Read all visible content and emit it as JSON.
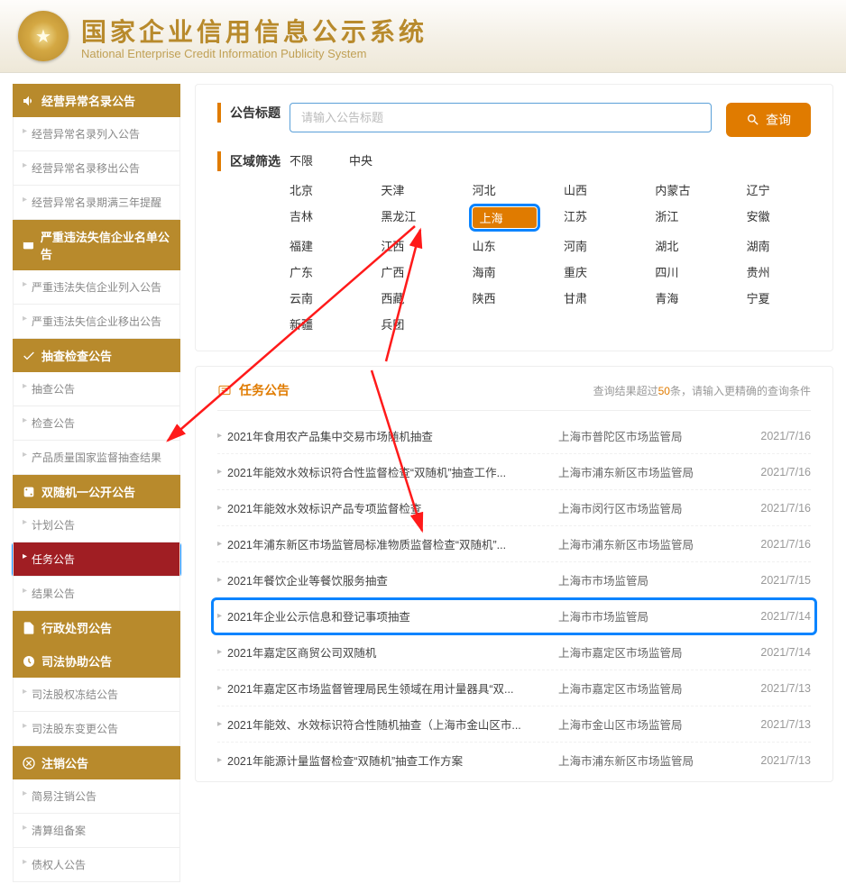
{
  "header": {
    "title_cn": "国家企业信用信息公示系统",
    "title_en": "National Enterprise Credit Information Publicity System"
  },
  "sidebar": [
    {
      "head": "经营异常名录公告",
      "icon": "speaker-icon",
      "items": [
        "经营异常名录列入公告",
        "经营异常名录移出公告",
        "经营异常名录期满三年提醒"
      ]
    },
    {
      "head": "严重违法失信企业名单公告",
      "icon": "warning-icon",
      "items": [
        "严重违法失信企业列入公告",
        "严重违法失信企业移出公告"
      ]
    },
    {
      "head": "抽查检查公告",
      "icon": "check-icon",
      "items": [
        "抽查公告",
        "检查公告",
        "产品质量国家监督抽查结果"
      ]
    },
    {
      "head": "双随机一公开公告",
      "icon": "dice-icon",
      "items": [
        "计划公告",
        "任务公告",
        "结果公告"
      ],
      "active_index": 1
    },
    {
      "head": "行政处罚公告",
      "icon": "doc-icon",
      "items": []
    },
    {
      "head": "司法协助公告",
      "icon": "gavel-icon",
      "items": [
        "司法股权冻结公告",
        "司法股东变更公告"
      ]
    },
    {
      "head": "注销公告",
      "icon": "cancel-icon",
      "items": [
        "简易注销公告",
        "清算组备案",
        "债权人公告"
      ]
    }
  ],
  "search": {
    "label": "公告标题",
    "placeholder": "请输入公告标题",
    "button": "查询"
  },
  "region": {
    "label": "区域筛选",
    "top_row": [
      "不限",
      "中央"
    ],
    "cells": [
      "北京",
      "天津",
      "河北",
      "山西",
      "内蒙古",
      "辽宁",
      "吉林",
      "黑龙江",
      "上海",
      "江苏",
      "浙江",
      "安徽",
      "福建",
      "江西",
      "山东",
      "河南",
      "湖北",
      "湖南",
      "广东",
      "广西",
      "海南",
      "重庆",
      "四川",
      "贵州",
      "云南",
      "西藏",
      "陕西",
      "甘肃",
      "青海",
      "宁夏",
      "新疆",
      "兵团"
    ],
    "selected": "上海"
  },
  "results": {
    "title": "任务公告",
    "hint_prefix": "查询结果超过",
    "hint_count": "50",
    "hint_suffix": "条，请输入更精确的查询条件",
    "rows": [
      {
        "name": "2021年食用农产品集中交易市场随机抽查",
        "org": "上海市普陀区市场监管局",
        "date": "2021/7/16"
      },
      {
        "name": "2021年能效水效标识符合性监督检查“双随机”抽查工作...",
        "org": "上海市浦东新区市场监管局",
        "date": "2021/7/16"
      },
      {
        "name": "2021年能效水效标识产品专项监督检查",
        "org": "上海市闵行区市场监管局",
        "date": "2021/7/16"
      },
      {
        "name": "2021年浦东新区市场监管局标准物质监督检查“双随机”...",
        "org": "上海市浦东新区市场监管局",
        "date": "2021/7/16"
      },
      {
        "name": "2021年餐饮企业等餐饮服务抽查",
        "org": "上海市市场监管局",
        "date": "2021/7/15"
      },
      {
        "name": "2021年企业公示信息和登记事项抽查",
        "org": "上海市市场监管局",
        "date": "2021/7/14"
      },
      {
        "name": "2021年嘉定区商贸公司双随机",
        "org": "上海市嘉定区市场监管局",
        "date": "2021/7/14"
      },
      {
        "name": "2021年嘉定区市场监督管理局民生领域在用计量器具“双...",
        "org": "上海市嘉定区市场监管局",
        "date": "2021/7/13"
      },
      {
        "name": "2021年能效、水效标识符合性随机抽查（上海市金山区市...",
        "org": "上海市金山区市场监管局",
        "date": "2021/7/13"
      },
      {
        "name": "2021年能源计量监督检查“双随机”抽查工作方案",
        "org": "上海市浦东新区市场监管局",
        "date": "2021/7/13"
      }
    ],
    "highlight_index": 5
  }
}
